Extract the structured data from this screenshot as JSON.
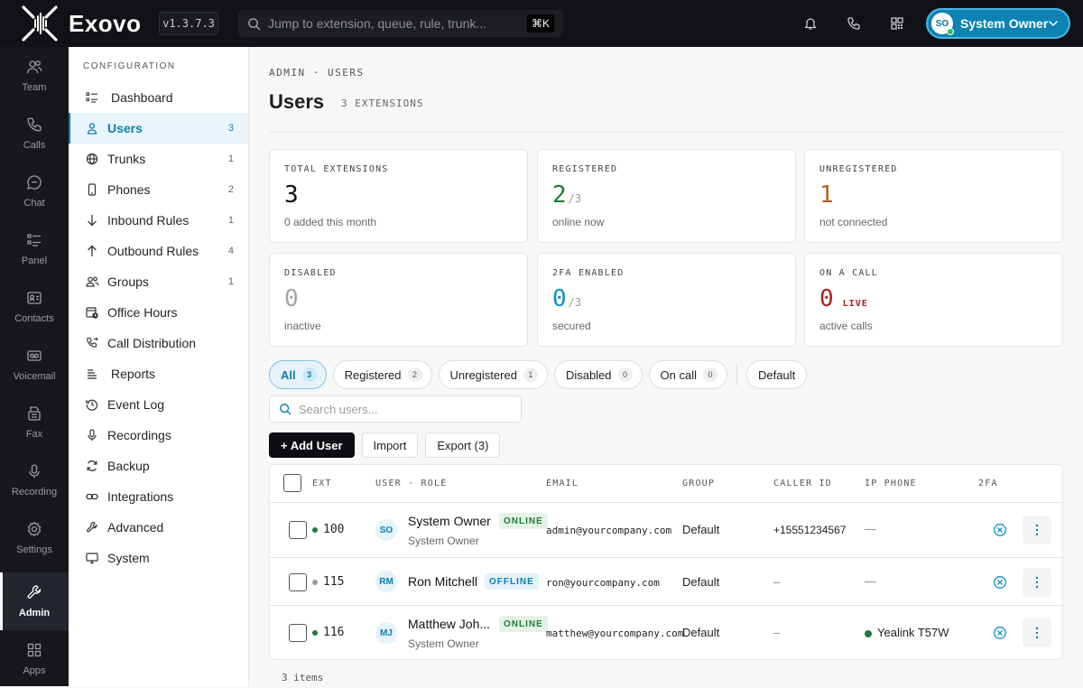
{
  "app": {
    "name": "Exovo",
    "version": "v1.3.7.3"
  },
  "search": {
    "placeholder": "Jump to extension, queue, rule, trunk...",
    "shortcut": "⌘K"
  },
  "user_menu": {
    "initials": "SO",
    "name": "System Owner"
  },
  "rail": [
    {
      "label": "Team",
      "icon": "team-icon"
    },
    {
      "label": "Calls",
      "icon": "phone-icon"
    },
    {
      "label": "Chat",
      "icon": "chat-icon"
    },
    {
      "label": "Panel",
      "icon": "panel-icon"
    },
    {
      "label": "Contacts",
      "icon": "contacts-icon"
    },
    {
      "label": "Voicemail",
      "icon": "voicemail-icon"
    },
    {
      "label": "Fax",
      "icon": "fax-icon"
    },
    {
      "label": "Recording",
      "icon": "microphone-icon"
    },
    {
      "label": "Settings",
      "icon": "gear-icon"
    },
    {
      "label": "Admin",
      "icon": "wrench-icon"
    },
    {
      "label": "Apps",
      "icon": "apps-icon"
    }
  ],
  "config": {
    "heading": "CONFIGURATION",
    "items": [
      {
        "label": "Dashboard",
        "count": ""
      },
      {
        "label": "Users",
        "count": "3"
      },
      {
        "label": "Trunks",
        "count": "1"
      },
      {
        "label": "Phones",
        "count": "2"
      },
      {
        "label": "Inbound Rules",
        "count": "1"
      },
      {
        "label": "Outbound Rules",
        "count": "4"
      },
      {
        "label": "Groups",
        "count": "1"
      },
      {
        "label": "Office Hours",
        "count": ""
      },
      {
        "label": "Call Distribution",
        "count": ""
      },
      {
        "label": "Reports",
        "count": ""
      },
      {
        "label": "Event Log",
        "count": ""
      },
      {
        "label": "Recordings",
        "count": ""
      },
      {
        "label": "Backup",
        "count": ""
      },
      {
        "label": "Integrations",
        "count": ""
      },
      {
        "label": "Advanced",
        "count": ""
      },
      {
        "label": "System",
        "count": ""
      }
    ]
  },
  "page": {
    "breadcrumb": "ADMIN · USERS",
    "title": "Users",
    "subtitle": "3 EXTENSIONS"
  },
  "stats": [
    {
      "label": "TOTAL EXTENSIONS",
      "value": "3",
      "of": "",
      "extra": "",
      "desc": "0 added this month",
      "color": "#111111"
    },
    {
      "label": "REGISTERED",
      "value": "2",
      "of": "/3",
      "extra": "",
      "desc": "online now",
      "color": "#1e7a36"
    },
    {
      "label": "UNREGISTERED",
      "value": "1",
      "of": "",
      "extra": "",
      "desc": "not connected",
      "color": "#b5611a"
    },
    {
      "label": "DISABLED",
      "value": "0",
      "of": "",
      "extra": "",
      "desc": "inactive",
      "color": "#a0a3a8"
    },
    {
      "label": "2FA ENABLED",
      "value": "0",
      "of": "/3",
      "extra": "",
      "desc": "secured",
      "color": "#0b8fcc"
    },
    {
      "label": "ON A CALL",
      "value": "0",
      "of": "",
      "extra": "LIVE",
      "desc": "active calls",
      "color": "#b11c1c"
    }
  ],
  "filters": [
    {
      "label": "All",
      "count": "3"
    },
    {
      "label": "Registered",
      "count": "2"
    },
    {
      "label": "Unregistered",
      "count": "1"
    },
    {
      "label": "Disabled",
      "count": "0"
    },
    {
      "label": "On call",
      "count": "0"
    }
  ],
  "group_filter": "Default",
  "user_search": {
    "placeholder": "Search users..."
  },
  "buttons": {
    "add": "+ Add User",
    "import": "Import",
    "export": "Export (3)"
  },
  "table": {
    "columns": [
      "EXT",
      "USER · ROLE",
      "EMAIL",
      "GROUP",
      "CALLER ID",
      "IP PHONE",
      "2FA"
    ],
    "rows": [
      {
        "ext": "100",
        "status_color": "#1e7a36",
        "initials": "SO",
        "name": "System Owner",
        "badge": "ONLINE",
        "online": true,
        "role": "System Owner",
        "email": "admin@yourcompany.com",
        "group": "Default",
        "caller_id": "+15551234567",
        "ip_phone": "—",
        "phone_dot": false
      },
      {
        "ext": "115",
        "status_color": "#9a9ca2",
        "initials": "RM",
        "name": "Ron Mitchell",
        "badge": "OFFLINE",
        "online": false,
        "role": "",
        "email": "ron@yourcompany.com",
        "group": "Default",
        "caller_id": "–",
        "ip_phone": "—",
        "phone_dot": false
      },
      {
        "ext": "116",
        "status_color": "#1e7a36",
        "initials": "MJ",
        "name": "Matthew Joh...",
        "badge": "ONLINE",
        "online": true,
        "role": "System Owner",
        "email": "matthew@yourcompany.com",
        "group": "Default",
        "caller_id": "–",
        "ip_phone": "Yealink T57W",
        "phone_dot": true
      }
    ]
  },
  "footer": "3 items"
}
